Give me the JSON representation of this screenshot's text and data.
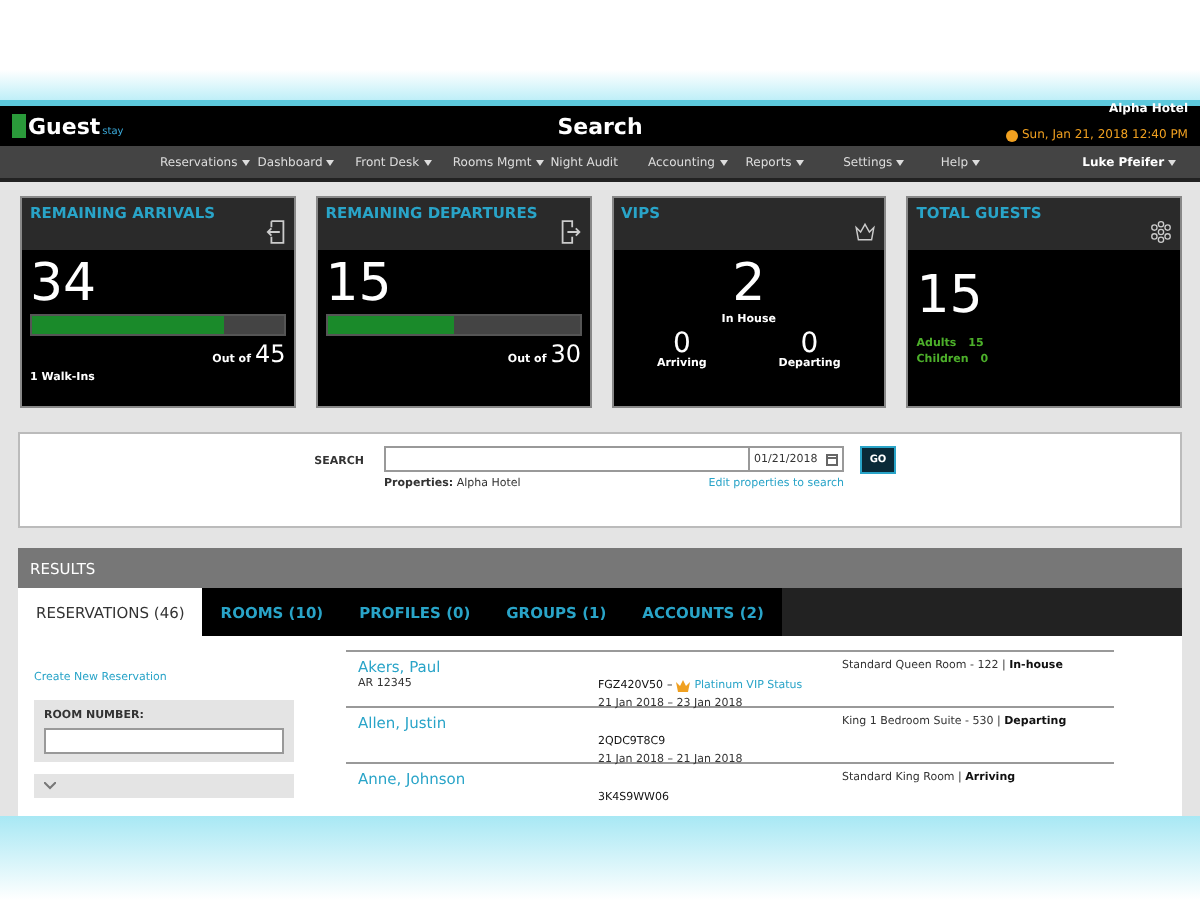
{
  "header": {
    "logo": "Guest",
    "logo_sub": "stay",
    "title": "Search",
    "hotel": "Alpha Hotel",
    "datetime": "Sun, Jan 21, 2018 12:40 PM"
  },
  "nav": {
    "items": [
      {
        "label": "Reservations",
        "dropdown": true
      },
      {
        "label": "Dashboard",
        "dropdown": true
      },
      {
        "label": "Front Desk",
        "dropdown": true
      },
      {
        "label": "Rooms Mgmt",
        "dropdown": true
      },
      {
        "label": "Night Audit",
        "dropdown": false
      },
      {
        "label": "Accounting",
        "dropdown": true
      },
      {
        "label": "Reports",
        "dropdown": true
      },
      {
        "label": "Settings",
        "dropdown": true
      },
      {
        "label": "Help",
        "dropdown": true
      }
    ],
    "user": "Luke Pfeifer"
  },
  "cards": [
    {
      "kind": "progress",
      "title": "REMAINING ARRIVALS",
      "value": "34",
      "level": 0.76,
      "out_of_label": "Out of",
      "out_of": "45",
      "note": "1 Walk-Ins"
    },
    {
      "kind": "progress",
      "title": "REMAINING DEPARTURES",
      "value": "15",
      "level": 0.5,
      "out_of_label": "Out of",
      "out_of": "30"
    },
    {
      "kind": "vip",
      "title": "VIPS",
      "value": "2",
      "value_label": "In House",
      "stats": [
        {
          "value": "0",
          "label": "Arriving"
        },
        {
          "value": "0",
          "label": "Departing"
        }
      ]
    },
    {
      "kind": "guests",
      "title": "TOTAL GUESTS",
      "value": "15",
      "stats": [
        {
          "label": "Adults",
          "value": "15"
        },
        {
          "label": "Children",
          "value": "0"
        }
      ]
    }
  ],
  "search": {
    "label": "SEARCH",
    "date": "01/21/2018",
    "go": "GO",
    "properties_label": "Properties:",
    "properties": "Alpha Hotel",
    "edit_link": "Edit properties to search"
  },
  "results": {
    "title": "RESULTS",
    "tabs": [
      {
        "label": "RESERVATIONS (46)",
        "selected": true
      },
      {
        "label": "ROOMS (10)",
        "selected": false
      },
      {
        "label": "PROFILES (0)",
        "selected": false
      },
      {
        "label": "GROUPS (1)",
        "selected": false
      },
      {
        "label": "ACCOUNTS (2)",
        "selected": false
      }
    ],
    "create_link": "Create New Reservation",
    "room_number_label": "ROOM NUMBER:",
    "rows": [
      {
        "name": "Akers, Paul",
        "account": "AR 12345",
        "code": "FGZ420V50",
        "vip_separator": "–",
        "vip": "Platinum VIP Status",
        "dates": "21 Jan 2018 – 23 Jan 2018",
        "room_status": "Standard Queen Room - 122 | **In-house**"
      },
      {
        "name": "Allen, Justin",
        "code": "2QDC9T8C9",
        "dates": "21 Jan 2018 – 21 Jan 2018",
        "room_status": "King 1 Bedroom Suite - 530 | **Departing**"
      },
      {
        "name": "Anne, Johnson",
        "code": "3K4S9WW06",
        "room_status": "Standard King Room | **Arriving**"
      }
    ]
  }
}
